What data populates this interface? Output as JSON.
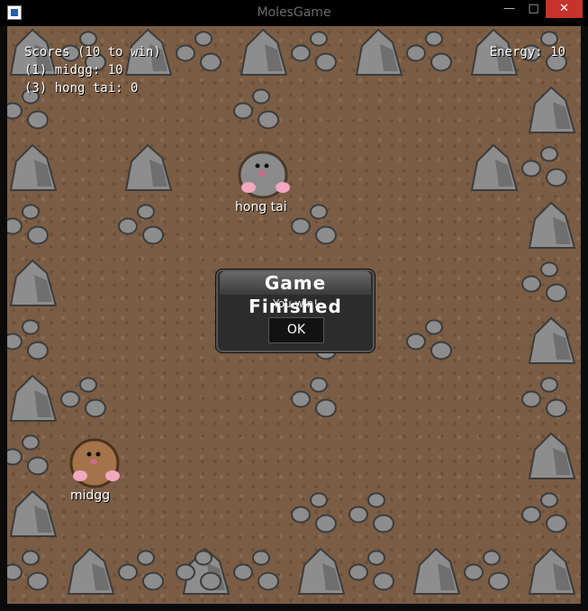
{
  "window": {
    "title": "MolesGame",
    "minimize": "—",
    "maximize": "□",
    "close": "✕"
  },
  "hud": {
    "scores_header": "Scores (10 to win)",
    "score_lines": [
      "(1) midgg: 10",
      "(3) hong tai: 0"
    ],
    "energy": "Energy: 10"
  },
  "players": [
    {
      "name": "hong tai",
      "color": "#8b8b8b"
    },
    {
      "name": "midgg",
      "color": "#a5734a"
    }
  ],
  "dialog": {
    "title": "Game Finished",
    "message": "You win!",
    "ok_label": "OK"
  },
  "colors": {
    "ground": "#7a5d44",
    "rock": "#8d8d8d",
    "close_button": "#c7322b"
  }
}
